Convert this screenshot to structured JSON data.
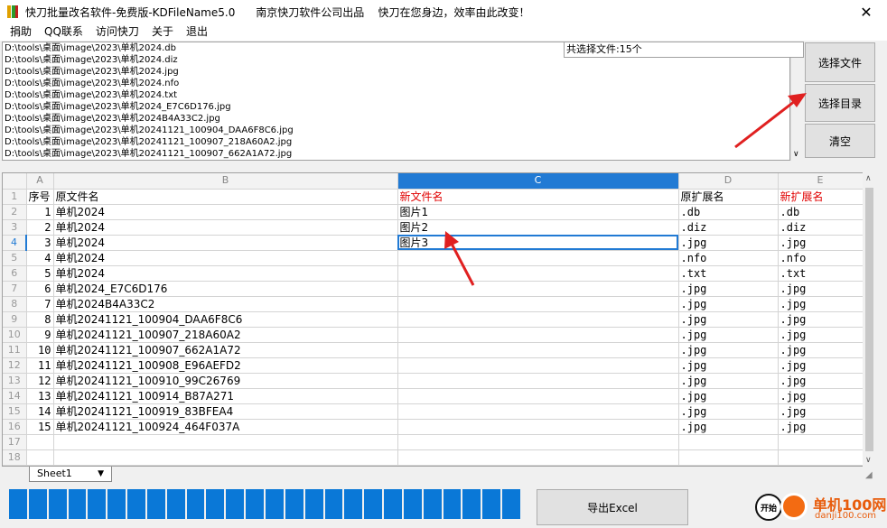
{
  "window": {
    "title": "快刀批量改名软件-免费版-KDFileName5.0      南京快刀软件公司出品    快刀在您身边，效率由此改变！",
    "close": "✕"
  },
  "menu": [
    "捐助",
    "QQ联系",
    "访问快刀",
    "关于",
    "退出"
  ],
  "file_list": [
    "D:\\tools\\桌面\\image\\2023\\单机2024.db",
    "D:\\tools\\桌面\\image\\2023\\单机2024.diz",
    "D:\\tools\\桌面\\image\\2023\\单机2024.jpg",
    "D:\\tools\\桌面\\image\\2023\\单机2024.nfo",
    "D:\\tools\\桌面\\image\\2023\\单机2024.txt",
    "D:\\tools\\桌面\\image\\2023\\单机2024_E7C6D176.jpg",
    "D:\\tools\\桌面\\image\\2023\\单机2024B4A33C2.jpg",
    "D:\\tools\\桌面\\image\\2023\\单机20241121_100904_DAA6F8C6.jpg",
    "D:\\tools\\桌面\\image\\2023\\单机20241121_100907_218A60A2.jpg",
    "D:\\tools\\桌面\\image\\2023\\单机20241121_100907_662A1A72.jpg"
  ],
  "selected_count": "共选择文件:15个",
  "buttons": {
    "select_files": "选择文件",
    "select_dir": "选择目录",
    "clear": "清空",
    "export_excel": "导出Excel",
    "start": "开始"
  },
  "grid": {
    "col_letters": [
      "A",
      "B",
      "C",
      "D",
      "E"
    ],
    "header_row": [
      "序号",
      "原文件名",
      "新文件名",
      "原扩展名",
      "新扩展名"
    ],
    "rows": [
      [
        "1",
        "单机2024",
        "图片1",
        ".db",
        ".db"
      ],
      [
        "2",
        "单机2024",
        "图片2",
        ".diz",
        ".diz"
      ],
      [
        "3",
        "单机2024",
        "图片3",
        ".jpg",
        ".jpg"
      ],
      [
        "4",
        "单机2024",
        "",
        ".nfo",
        ".nfo"
      ],
      [
        "5",
        "单机2024",
        "",
        ".txt",
        ".txt"
      ],
      [
        "6",
        "单机2024_E7C6D176",
        "",
        ".jpg",
        ".jpg"
      ],
      [
        "7",
        "单机2024B4A33C2",
        "",
        ".jpg",
        ".jpg"
      ],
      [
        "8",
        "单机20241121_100904_DAA6F8C6",
        "",
        ".jpg",
        ".jpg"
      ],
      [
        "9",
        "单机20241121_100907_218A60A2",
        "",
        ".jpg",
        ".jpg"
      ],
      [
        "10",
        "单机20241121_100907_662A1A72",
        "",
        ".jpg",
        ".jpg"
      ],
      [
        "11",
        "单机20241121_100908_E96AEFD2",
        "",
        ".jpg",
        ".jpg"
      ],
      [
        "12",
        "单机20241121_100910_99C26769",
        "",
        ".jpg",
        ".jpg"
      ],
      [
        "13",
        "单机20241121_100914_B87A271",
        "",
        ".jpg",
        ".jpg"
      ],
      [
        "14",
        "单机20241121_100919_83BFEA4",
        "",
        ".jpg",
        ".jpg"
      ],
      [
        "15",
        "单机20241121_100924_464F037A",
        "",
        ".jpg",
        ".jpg"
      ],
      [
        "",
        "",
        "",
        "",
        ""
      ],
      [
        "",
        "",
        "",
        "",
        ""
      ]
    ],
    "active_cell": "C4"
  },
  "sheet_tab": "Sheet1",
  "sheet_tab_arrow": "▼",
  "progress_segments": 26,
  "watermark": {
    "name": "单机100网",
    "url": "danji100.com"
  },
  "colors": {
    "accent": "#217ad4",
    "red_header": "#e00000",
    "progress": "#0a78d7",
    "arrow": "#e02020"
  }
}
